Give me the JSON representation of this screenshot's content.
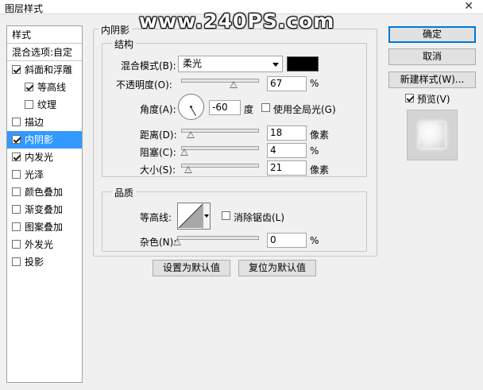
{
  "window": {
    "title": "图层样式",
    "close_glyph": "✕"
  },
  "watermark": "www.240PS.com",
  "style_list": {
    "header": "样式",
    "blend_options": "混合选项:自定",
    "items": [
      {
        "label": "斜面和浮雕",
        "checked": true,
        "sub": false,
        "selected": false
      },
      {
        "label": "等高线",
        "checked": true,
        "sub": true,
        "selected": false
      },
      {
        "label": "纹理",
        "checked": false,
        "sub": true,
        "selected": false
      },
      {
        "label": "描边",
        "checked": false,
        "sub": false,
        "selected": false
      },
      {
        "label": "内阴影",
        "checked": true,
        "sub": false,
        "selected": true
      },
      {
        "label": "内发光",
        "checked": true,
        "sub": false,
        "selected": false
      },
      {
        "label": "光泽",
        "checked": false,
        "sub": false,
        "selected": false
      },
      {
        "label": "颜色叠加",
        "checked": false,
        "sub": false,
        "selected": false
      },
      {
        "label": "渐变叠加",
        "checked": false,
        "sub": false,
        "selected": false
      },
      {
        "label": "图案叠加",
        "checked": false,
        "sub": false,
        "selected": false
      },
      {
        "label": "外发光",
        "checked": false,
        "sub": false,
        "selected": false
      },
      {
        "label": "投影",
        "checked": false,
        "sub": false,
        "selected": false
      }
    ]
  },
  "panel": {
    "section_title": "内阴影",
    "structure": {
      "title": "结构",
      "blend_mode_label": "混合模式(B):",
      "blend_mode_value": "柔光",
      "color": "#000000",
      "opacity_label": "不透明度(O):",
      "opacity_value": "67",
      "opacity_unit": "%",
      "opacity_level": 0.67,
      "angle_label": "角度(A):",
      "angle_value": "-60",
      "angle_unit": "度",
      "global_light_label": "使用全局光(G)",
      "global_light_checked": false,
      "distance_label": "距离(D):",
      "distance_value": "18",
      "distance_unit": "像素",
      "distance_level": 0.12,
      "choke_label": "阻塞(C):",
      "choke_value": "4",
      "choke_unit": "%",
      "choke_level": 0.04,
      "size_label": "大小(S):",
      "size_value": "21",
      "size_unit": "像素",
      "size_level": 0.09
    },
    "quality": {
      "title": "品质",
      "contour_label": "等高线:",
      "antialias_label": "消除锯齿(L)",
      "antialias_checked": false,
      "noise_label": "杂色(N):",
      "noise_value": "0",
      "noise_unit": "%",
      "noise_level": 0
    },
    "make_default": "设置为默认值",
    "reset_default": "复位为默认值"
  },
  "buttons": {
    "ok": "确定",
    "cancel": "取消",
    "new_style": "新建样式(W)...",
    "preview_label": "预览(V)",
    "preview_checked": true
  }
}
